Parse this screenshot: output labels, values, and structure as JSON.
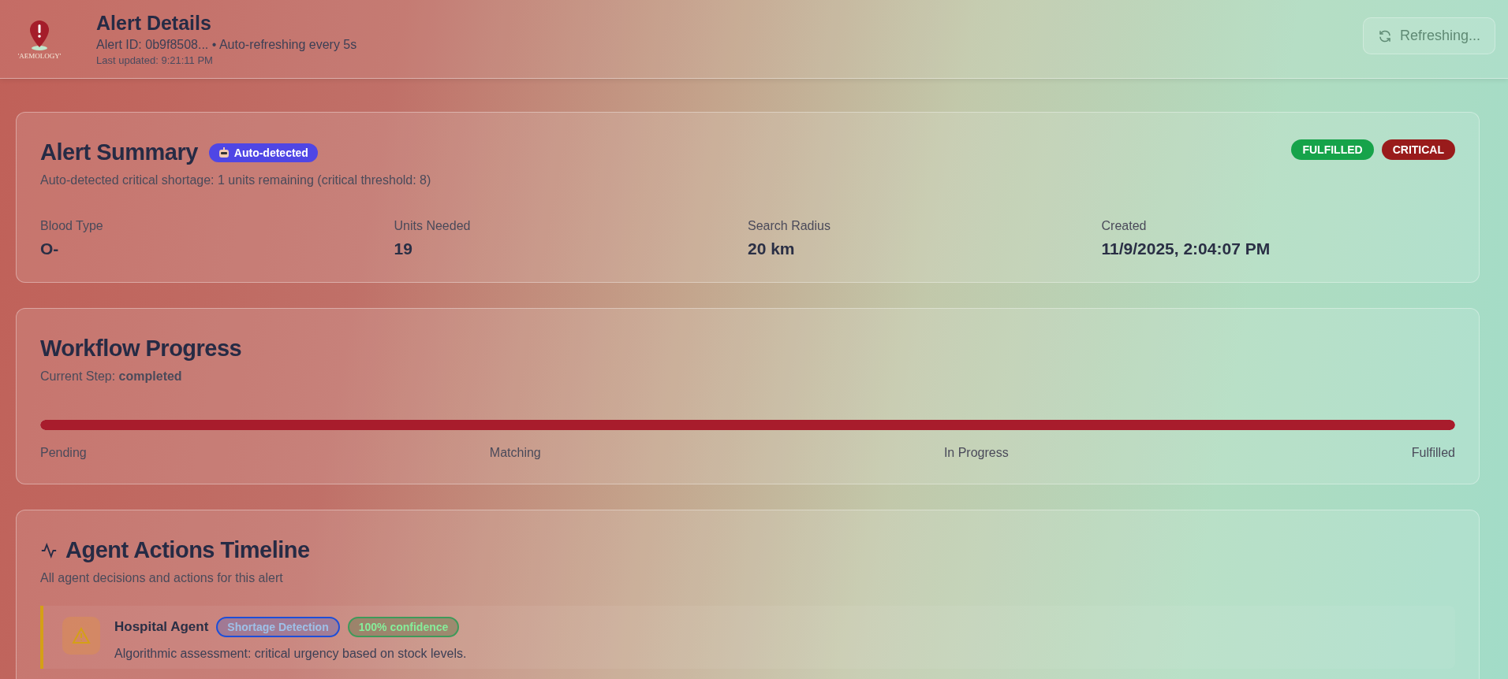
{
  "header": {
    "logo_text": "'AEMOLOGY'",
    "title": "Alert Details",
    "subtitle": "Alert ID: 0b9f8508... • Auto-refreshing every 5s",
    "last_updated": "Last updated: 9:21:11 PM",
    "refresh_button": {
      "label": "Refreshing...",
      "disabled": true
    }
  },
  "summary": {
    "title": "Alert Summary",
    "source_badge": "Auto-detected",
    "description": "Auto-detected critical shortage: 1 units remaining (critical threshold: 8)",
    "status_badges": [
      {
        "label": "FULFILLED",
        "color": "#16a34a"
      },
      {
        "label": "CRITICAL",
        "color": "#991b1b"
      }
    ],
    "fields": [
      {
        "label": "Blood Type",
        "value": "O-"
      },
      {
        "label": "Units Needed",
        "value": "19"
      },
      {
        "label": "Search Radius",
        "value": "20 km"
      },
      {
        "label": "Created",
        "value": "11/9/2025, 2:04:07 PM"
      }
    ]
  },
  "workflow": {
    "title": "Workflow Progress",
    "current_step": "Current Step: **completed**",
    "level": 1,
    "steps": [
      "Pending",
      "Matching",
      "In Progress",
      "Fulfilled"
    ]
  },
  "timeline": {
    "title": "Agent Actions Timeline",
    "subtitle": "All agent decisions and actions for this alert",
    "entries": [
      {
        "agent": "Hospital Agent",
        "color": "#d4a017",
        "tags": [
          {
            "label": "Shortage Detection",
            "kind": "action"
          },
          {
            "label": "100% confidence",
            "kind": "confidence"
          }
        ],
        "description": "Algorithmic assessment: critical urgency based on stock levels."
      }
    ]
  }
}
